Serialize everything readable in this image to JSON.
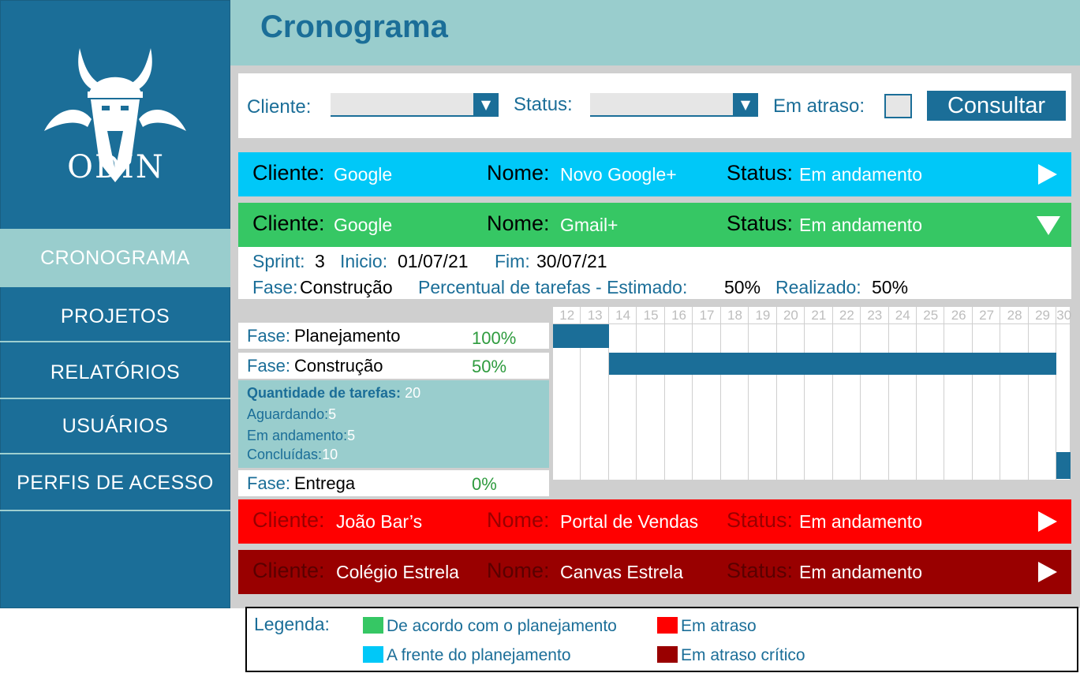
{
  "page_title": "Cronograma",
  "logo_text": "ODIN",
  "nav": [
    {
      "label": "CRONOGRAMA",
      "active": true
    },
    {
      "label": "PROJETOS"
    },
    {
      "label": "RELATÓRIOS"
    },
    {
      "label": "USUÁRIOS"
    },
    {
      "label": "PERFIS DE ACESSO"
    }
  ],
  "filters": {
    "cliente_label": "Cliente:",
    "status_label": "Status:",
    "late_label": "Em atraso:",
    "consult_button": "Consultar",
    "cliente_value": "",
    "status_value": ""
  },
  "projects": [
    {
      "cliente_label": "Cliente:",
      "cliente": "Google",
      "nome_label": "Nome:",
      "nome": "Novo Google+",
      "status_label": "Status:",
      "status": "Em andamento",
      "color": "#00c8f8",
      "expanded": false
    },
    {
      "cliente_label": "Cliente:",
      "cliente": "Google",
      "nome_label": "Nome:",
      "nome": "Gmail+",
      "status_label": "Status:",
      "status": "Em andamento",
      "color": "#36c764",
      "expanded": true
    },
    {
      "cliente_label": "Cliente:",
      "cliente": "João Bar’s",
      "nome_label": "Nome:",
      "nome": "Portal de Vendas",
      "status_label": "Status:",
      "status": "Em andamento",
      "color": "#ff0000",
      "expanded": false
    },
    {
      "cliente_label": "Cliente:",
      "cliente": "Colégio Estrela",
      "nome_label": "Nome:",
      "nome": "Canvas Estrela",
      "status_label": "Status:",
      "status": "Em andamento",
      "color": "#990000",
      "expanded": false
    }
  ],
  "detail": {
    "sprint_label": "Sprint:",
    "sprint": "3",
    "inicio_label": "Inicio:",
    "inicio": "01/07/21",
    "fim_label": "Fim:",
    "fim": "30/07/21",
    "fase_label": "Fase:",
    "fase": "Construção",
    "estimado_label": "Percentual de tarefas - Estimado:",
    "estimado": "50%",
    "realizado_label": "Realizado:",
    "realizado": "50%"
  },
  "phases": [
    {
      "label": "Fase:",
      "name": "Planejamento",
      "pct": "100%"
    },
    {
      "label": "Fase:",
      "name": "Construção",
      "pct": "50%"
    },
    {
      "label": "Fase:",
      "name": "Entrega",
      "pct": "0%"
    }
  ],
  "tasks": {
    "total_label": "Quantidade de tarefas:",
    "total": "20",
    "waiting_label": "Aguardando:",
    "waiting": "5",
    "progress_label": "Em andamento:",
    "progress": "5",
    "done_label": "Concluídas:",
    "done": "10"
  },
  "gantt": {
    "days": [
      "12",
      "13",
      "14",
      "15",
      "16",
      "17",
      "18",
      "19",
      "20",
      "21",
      "22",
      "23",
      "24",
      "25",
      "26",
      "27",
      "28",
      "29",
      "30"
    ],
    "bars": [
      {
        "phase": "Planejamento",
        "start": "12",
        "end": "13"
      },
      {
        "phase": "Construção",
        "start": "14",
        "end": "29"
      },
      {
        "phase": "Entrega",
        "start": "30",
        "end": "30"
      }
    ]
  },
  "legend": {
    "title": "Legenda:",
    "items": [
      {
        "label": "De acordo com o planejamento",
        "color": "#36c764"
      },
      {
        "label": "A frente do planejamento",
        "color": "#00c8f8"
      },
      {
        "label": "Em atraso",
        "color": "#ff0000"
      },
      {
        "label": "Em atraso crítico",
        "color": "#990000"
      }
    ]
  }
}
